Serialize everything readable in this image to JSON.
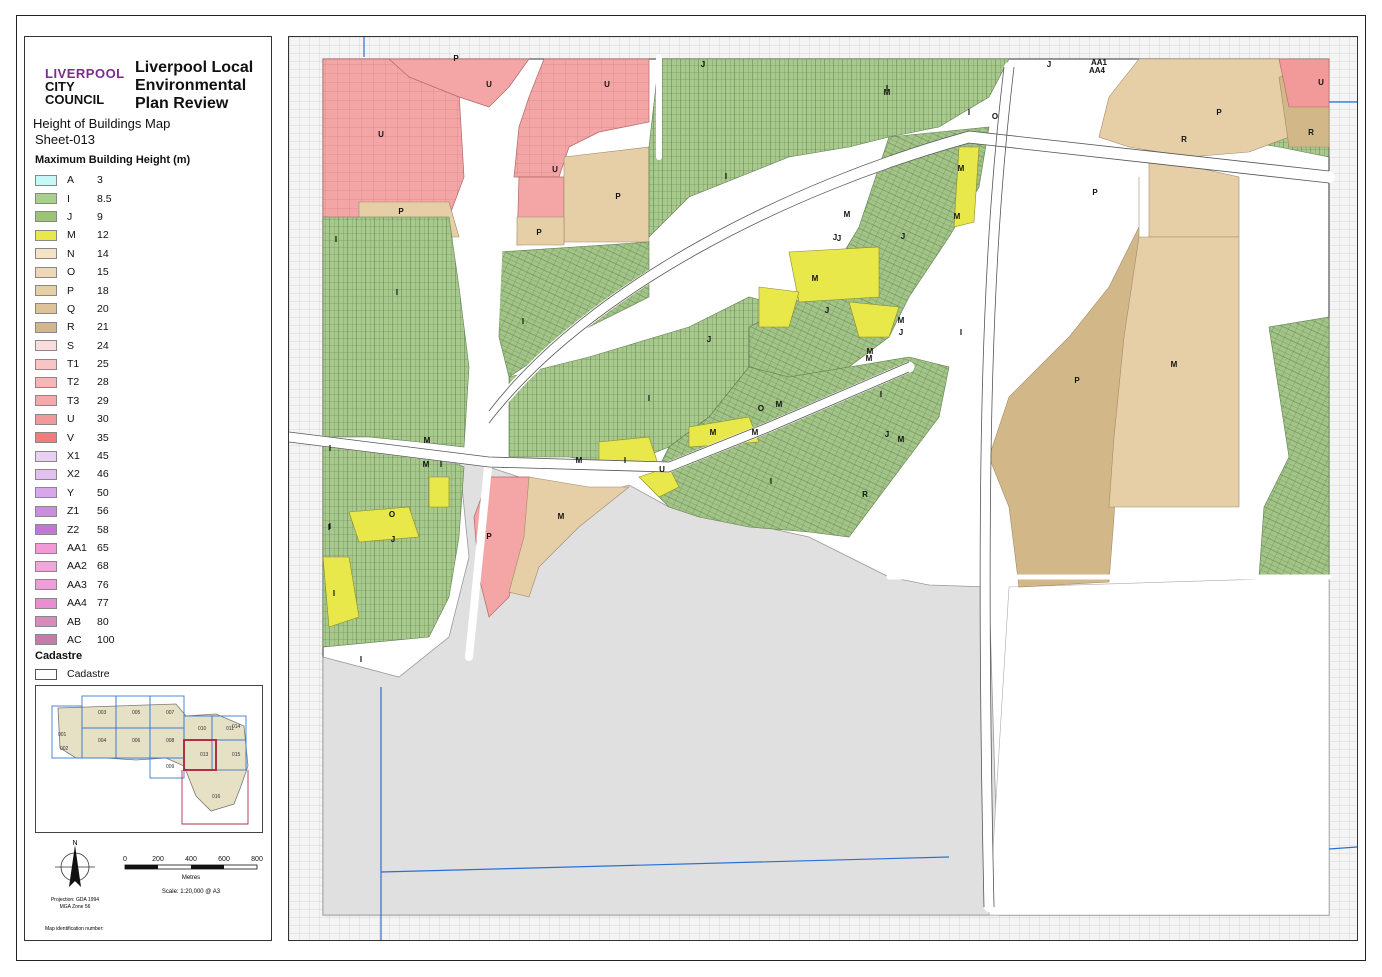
{
  "header": {
    "logo_line1": "LIVERPOOL",
    "logo_line2": "CITY",
    "logo_line3": "COUNCIL",
    "title": "Liverpool Local Environmental Plan Review",
    "map_name": "Height of Buildings Map",
    "sheet": "Sheet-013"
  },
  "legend": {
    "title": "Maximum Building Height (m)",
    "items": [
      {
        "code": "A",
        "height": "3",
        "color": "#c8f7f7"
      },
      {
        "code": "I",
        "height": "8.5",
        "color": "#a8d08d"
      },
      {
        "code": "J",
        "height": "9",
        "color": "#9bc47a"
      },
      {
        "code": "M",
        "height": "12",
        "color": "#e8e84a"
      },
      {
        "code": "N",
        "height": "14",
        "color": "#f5e3c8"
      },
      {
        "code": "O",
        "height": "15",
        "color": "#eed8b8"
      },
      {
        "code": "P",
        "height": "18",
        "color": "#e6cfa6"
      },
      {
        "code": "Q",
        "height": "20",
        "color": "#dcc39a"
      },
      {
        "code": "R",
        "height": "21",
        "color": "#d2b888"
      },
      {
        "code": "S",
        "height": "24",
        "color": "#fadcdc"
      },
      {
        "code": "T1",
        "height": "25",
        "color": "#f8c4c4"
      },
      {
        "code": "T2",
        "height": "28",
        "color": "#f6b6b6"
      },
      {
        "code": "T3",
        "height": "29",
        "color": "#f4aaaa"
      },
      {
        "code": "U",
        "height": "30",
        "color": "#f29a9a"
      },
      {
        "code": "V",
        "height": "35",
        "color": "#ef7d7d"
      },
      {
        "code": "X1",
        "height": "45",
        "color": "#ecd0f4"
      },
      {
        "code": "X2",
        "height": "46",
        "color": "#e3c0ef"
      },
      {
        "code": "Y",
        "height": "50",
        "color": "#d8a6ea"
      },
      {
        "code": "Z1",
        "height": "56",
        "color": "#c98ee2"
      },
      {
        "code": "Z2",
        "height": "58",
        "color": "#bd78da"
      },
      {
        "code": "AA1",
        "height": "65",
        "color": "#f29ad8"
      },
      {
        "code": "AA2",
        "height": "68",
        "color": "#f0a8dc"
      },
      {
        "code": "AA3",
        "height": "76",
        "color": "#ee9ed8"
      },
      {
        "code": "AA4",
        "height": "77",
        "color": "#ea8ed2"
      },
      {
        "code": "AB",
        "height": "80",
        "color": "#d88cbc"
      },
      {
        "code": "AC",
        "height": "100",
        "color": "#c87aa8"
      }
    ],
    "cadastre_title": "Cadastre",
    "cadastre_label": "Cadastre"
  },
  "inset": {
    "sheets": [
      "001",
      "002",
      "003",
      "004",
      "005",
      "006",
      "007",
      "008",
      "009",
      "010",
      "011",
      "013",
      "014",
      "015",
      "016"
    ]
  },
  "scale": {
    "ticks": [
      "0",
      "200",
      "400",
      "600",
      "800"
    ],
    "unit": "Metres",
    "scale_text": "Scale: 1:20,000 @ A3",
    "north": "N",
    "projection": "Projection: GDA 1994",
    "zone": "MGA Zone 56",
    "map_id": "Map identification number:"
  },
  "map": {
    "labels": [
      "P",
      "U",
      "U",
      "U",
      "U",
      "P",
      "P",
      "P",
      "J",
      "I",
      "M",
      "I",
      "O",
      "J",
      "AA1",
      "AA4",
      "U",
      "P",
      "R",
      "R",
      "P",
      "I",
      "M",
      "M",
      "M",
      "J",
      "J",
      "M",
      "I",
      "I",
      "J",
      "I",
      "J",
      "M",
      "M",
      "I",
      "J",
      "J",
      "I",
      "M",
      "O",
      "M",
      "M",
      "I",
      "M",
      "M",
      "I",
      "M",
      "I",
      "M",
      "I",
      "U",
      "P",
      "M",
      "O",
      "I",
      "J",
      "I",
      "I",
      "I",
      "R",
      "P",
      "M",
      "M",
      "J",
      "I"
    ]
  },
  "colors": {
    "residential_green": "#a8c98c",
    "lot_line": "#6e8a5e",
    "built_gray": "#dcdcdc",
    "water_blue": "#2a6fd6"
  }
}
